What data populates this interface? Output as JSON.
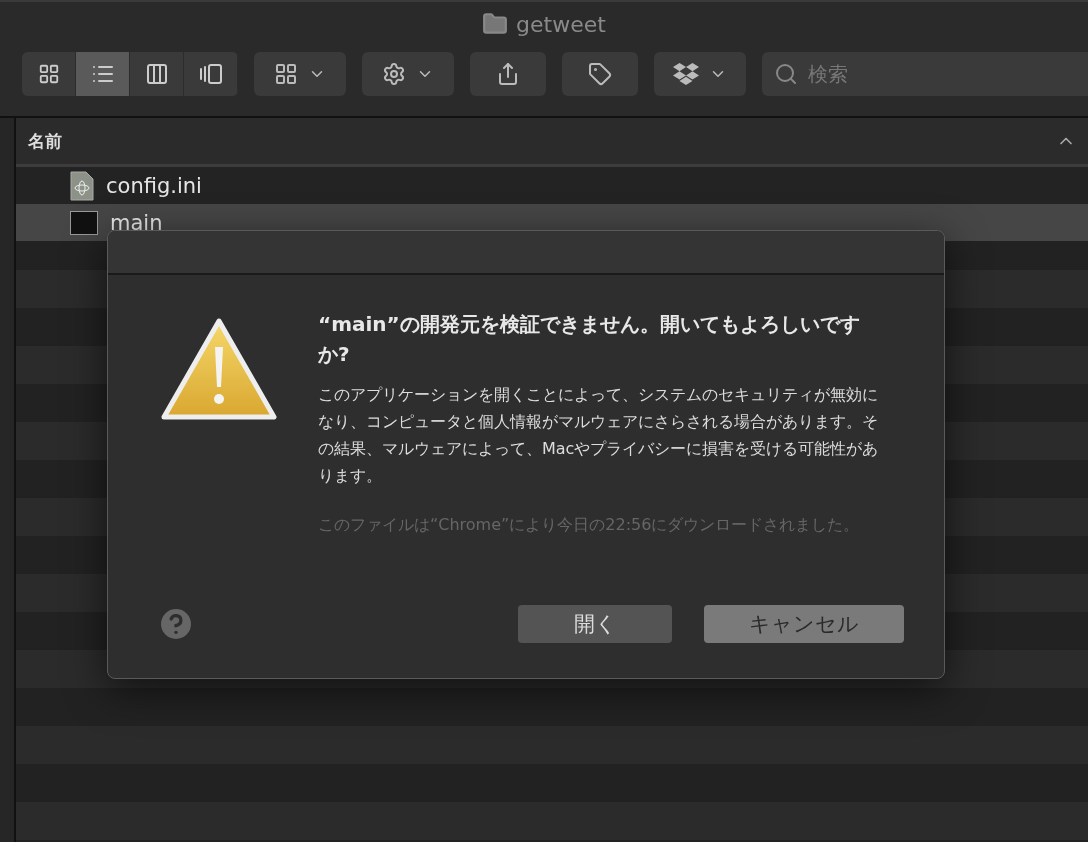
{
  "window": {
    "title": "getweet"
  },
  "view_buttons": [
    {
      "kind": "icons",
      "selected": false
    },
    {
      "kind": "list",
      "selected": true
    },
    {
      "kind": "columns",
      "selected": false
    },
    {
      "kind": "gallery",
      "selected": false
    }
  ],
  "toolbar": [
    {
      "kind": "group",
      "dropdown": true
    },
    {
      "kind": "action",
      "dropdown": true
    },
    {
      "kind": "share",
      "dropdown": false
    },
    {
      "kind": "tag",
      "dropdown": false
    },
    {
      "kind": "dropbox",
      "dropdown": true
    }
  ],
  "search": {
    "placeholder": "検索"
  },
  "column_header": {
    "label": "名前",
    "sorted": true
  },
  "files": [
    {
      "name": "config.ini",
      "kind": "config",
      "selected": false
    },
    {
      "name": "main",
      "kind": "executable",
      "selected": true
    }
  ],
  "dialog": {
    "title": "“main”の開発元を検証できません。開いてもよろしいですか?",
    "body": "このアプリケーションを開くことによって、システムのセキュリティが無効になり、コンピュータと個人情報がマルウェアにさらされる場合があります。その結果、マルウェアによって、Macやプライバシーに損害を受ける可能性があります。",
    "note": "このファイルは“Chrome”により今日の22:56にダウンロードされました。",
    "buttons": [
      {
        "label": "開く",
        "default": false
      },
      {
        "label": "キャンセル",
        "default": true
      }
    ]
  }
}
